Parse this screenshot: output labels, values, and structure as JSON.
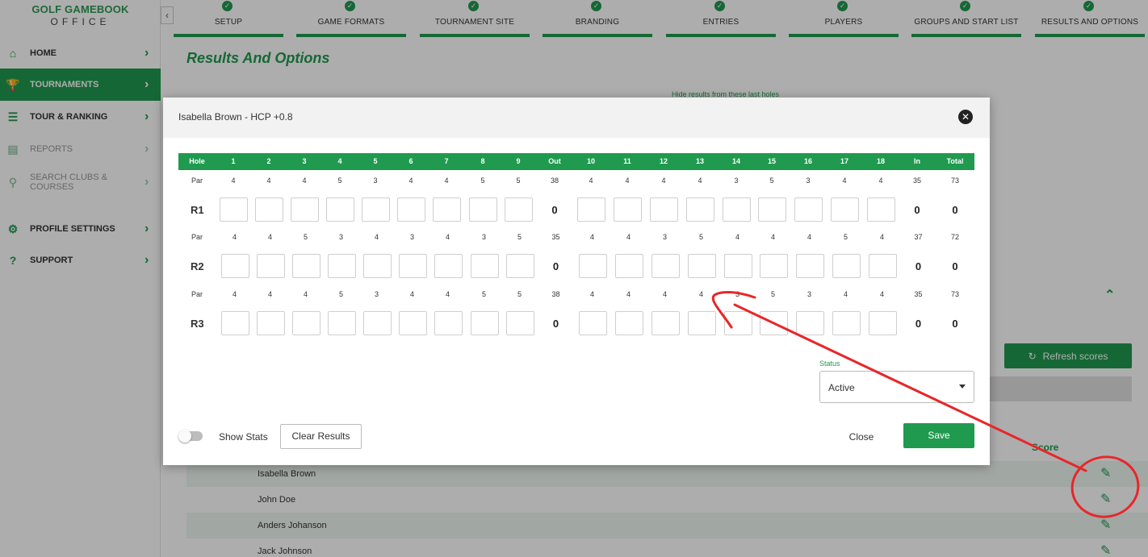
{
  "sidebar": {
    "logo_line1": "GOLF GAMEBOOK",
    "logo_line2": "OFFICE",
    "collapse_icon": "chevron-left-icon",
    "items": [
      {
        "label": "HOME",
        "icon": "home-icon",
        "active": false
      },
      {
        "label": "TOURNAMENTS",
        "icon": "trophy-icon",
        "active": true
      },
      {
        "label": "TOUR & RANKING",
        "icon": "list-icon",
        "active": false
      },
      {
        "label": "REPORTS",
        "icon": "report-icon",
        "active": false
      },
      {
        "label": "SEARCH CLUBS & COURSES",
        "icon": "search-icon",
        "active": false
      },
      {
        "label": "PROFILE SETTINGS",
        "icon": "gear-icon",
        "active": false
      },
      {
        "label": "SUPPORT",
        "icon": "help-icon",
        "active": false
      }
    ]
  },
  "stepper": [
    {
      "label": "SETUP"
    },
    {
      "label": "GAME FORMATS"
    },
    {
      "label": "TOURNAMENT SITE"
    },
    {
      "label": "BRANDING"
    },
    {
      "label": "ENTRIES"
    },
    {
      "label": "PLAYERS"
    },
    {
      "label": "GROUPS AND START LIST"
    },
    {
      "label": "RESULTS AND OPTIONS"
    }
  ],
  "main": {
    "title": "Results And Options",
    "hide_results_label": "Hide results from these last holes",
    "refresh_label": "Refresh scores",
    "score_header": "Score",
    "players": [
      "Isabella Brown",
      "John Doe",
      "Anders Johanson",
      "Jack Johnson"
    ]
  },
  "modal": {
    "title": "Isabella Brown - HCP +0.8",
    "header": [
      "Hole",
      "1",
      "2",
      "3",
      "4",
      "5",
      "6",
      "7",
      "8",
      "9",
      "Out",
      "10",
      "11",
      "12",
      "13",
      "14",
      "15",
      "16",
      "17",
      "18",
      "In",
      "Total"
    ],
    "par_label": "Par",
    "rounds": [
      {
        "label": "R1",
        "par": [
          "4",
          "4",
          "4",
          "5",
          "3",
          "4",
          "4",
          "5",
          "5",
          "38",
          "4",
          "4",
          "4",
          "4",
          "3",
          "5",
          "3",
          "4",
          "4",
          "35",
          "73"
        ],
        "out": "0",
        "in": "0",
        "total": "0"
      },
      {
        "label": "R2",
        "par": [
          "4",
          "4",
          "5",
          "3",
          "4",
          "3",
          "4",
          "3",
          "5",
          "35",
          "4",
          "4",
          "3",
          "5",
          "4",
          "4",
          "4",
          "5",
          "4",
          "37",
          "72"
        ],
        "out": "0",
        "in": "0",
        "total": "0"
      },
      {
        "label": "R3",
        "par": [
          "4",
          "4",
          "4",
          "5",
          "3",
          "4",
          "4",
          "5",
          "5",
          "38",
          "4",
          "4",
          "4",
          "4",
          "3",
          "5",
          "3",
          "4",
          "4",
          "35",
          "73"
        ],
        "out": "0",
        "in": "0",
        "total": "0"
      }
    ],
    "status_label": "Status",
    "status_value": "Active",
    "show_stats_label": "Show Stats",
    "clear_results_label": "Clear Results",
    "close_label": "Close",
    "save_label": "Save"
  },
  "colors": {
    "brand_green": "#1f9a4f",
    "annotation_red": "#e8262a"
  }
}
